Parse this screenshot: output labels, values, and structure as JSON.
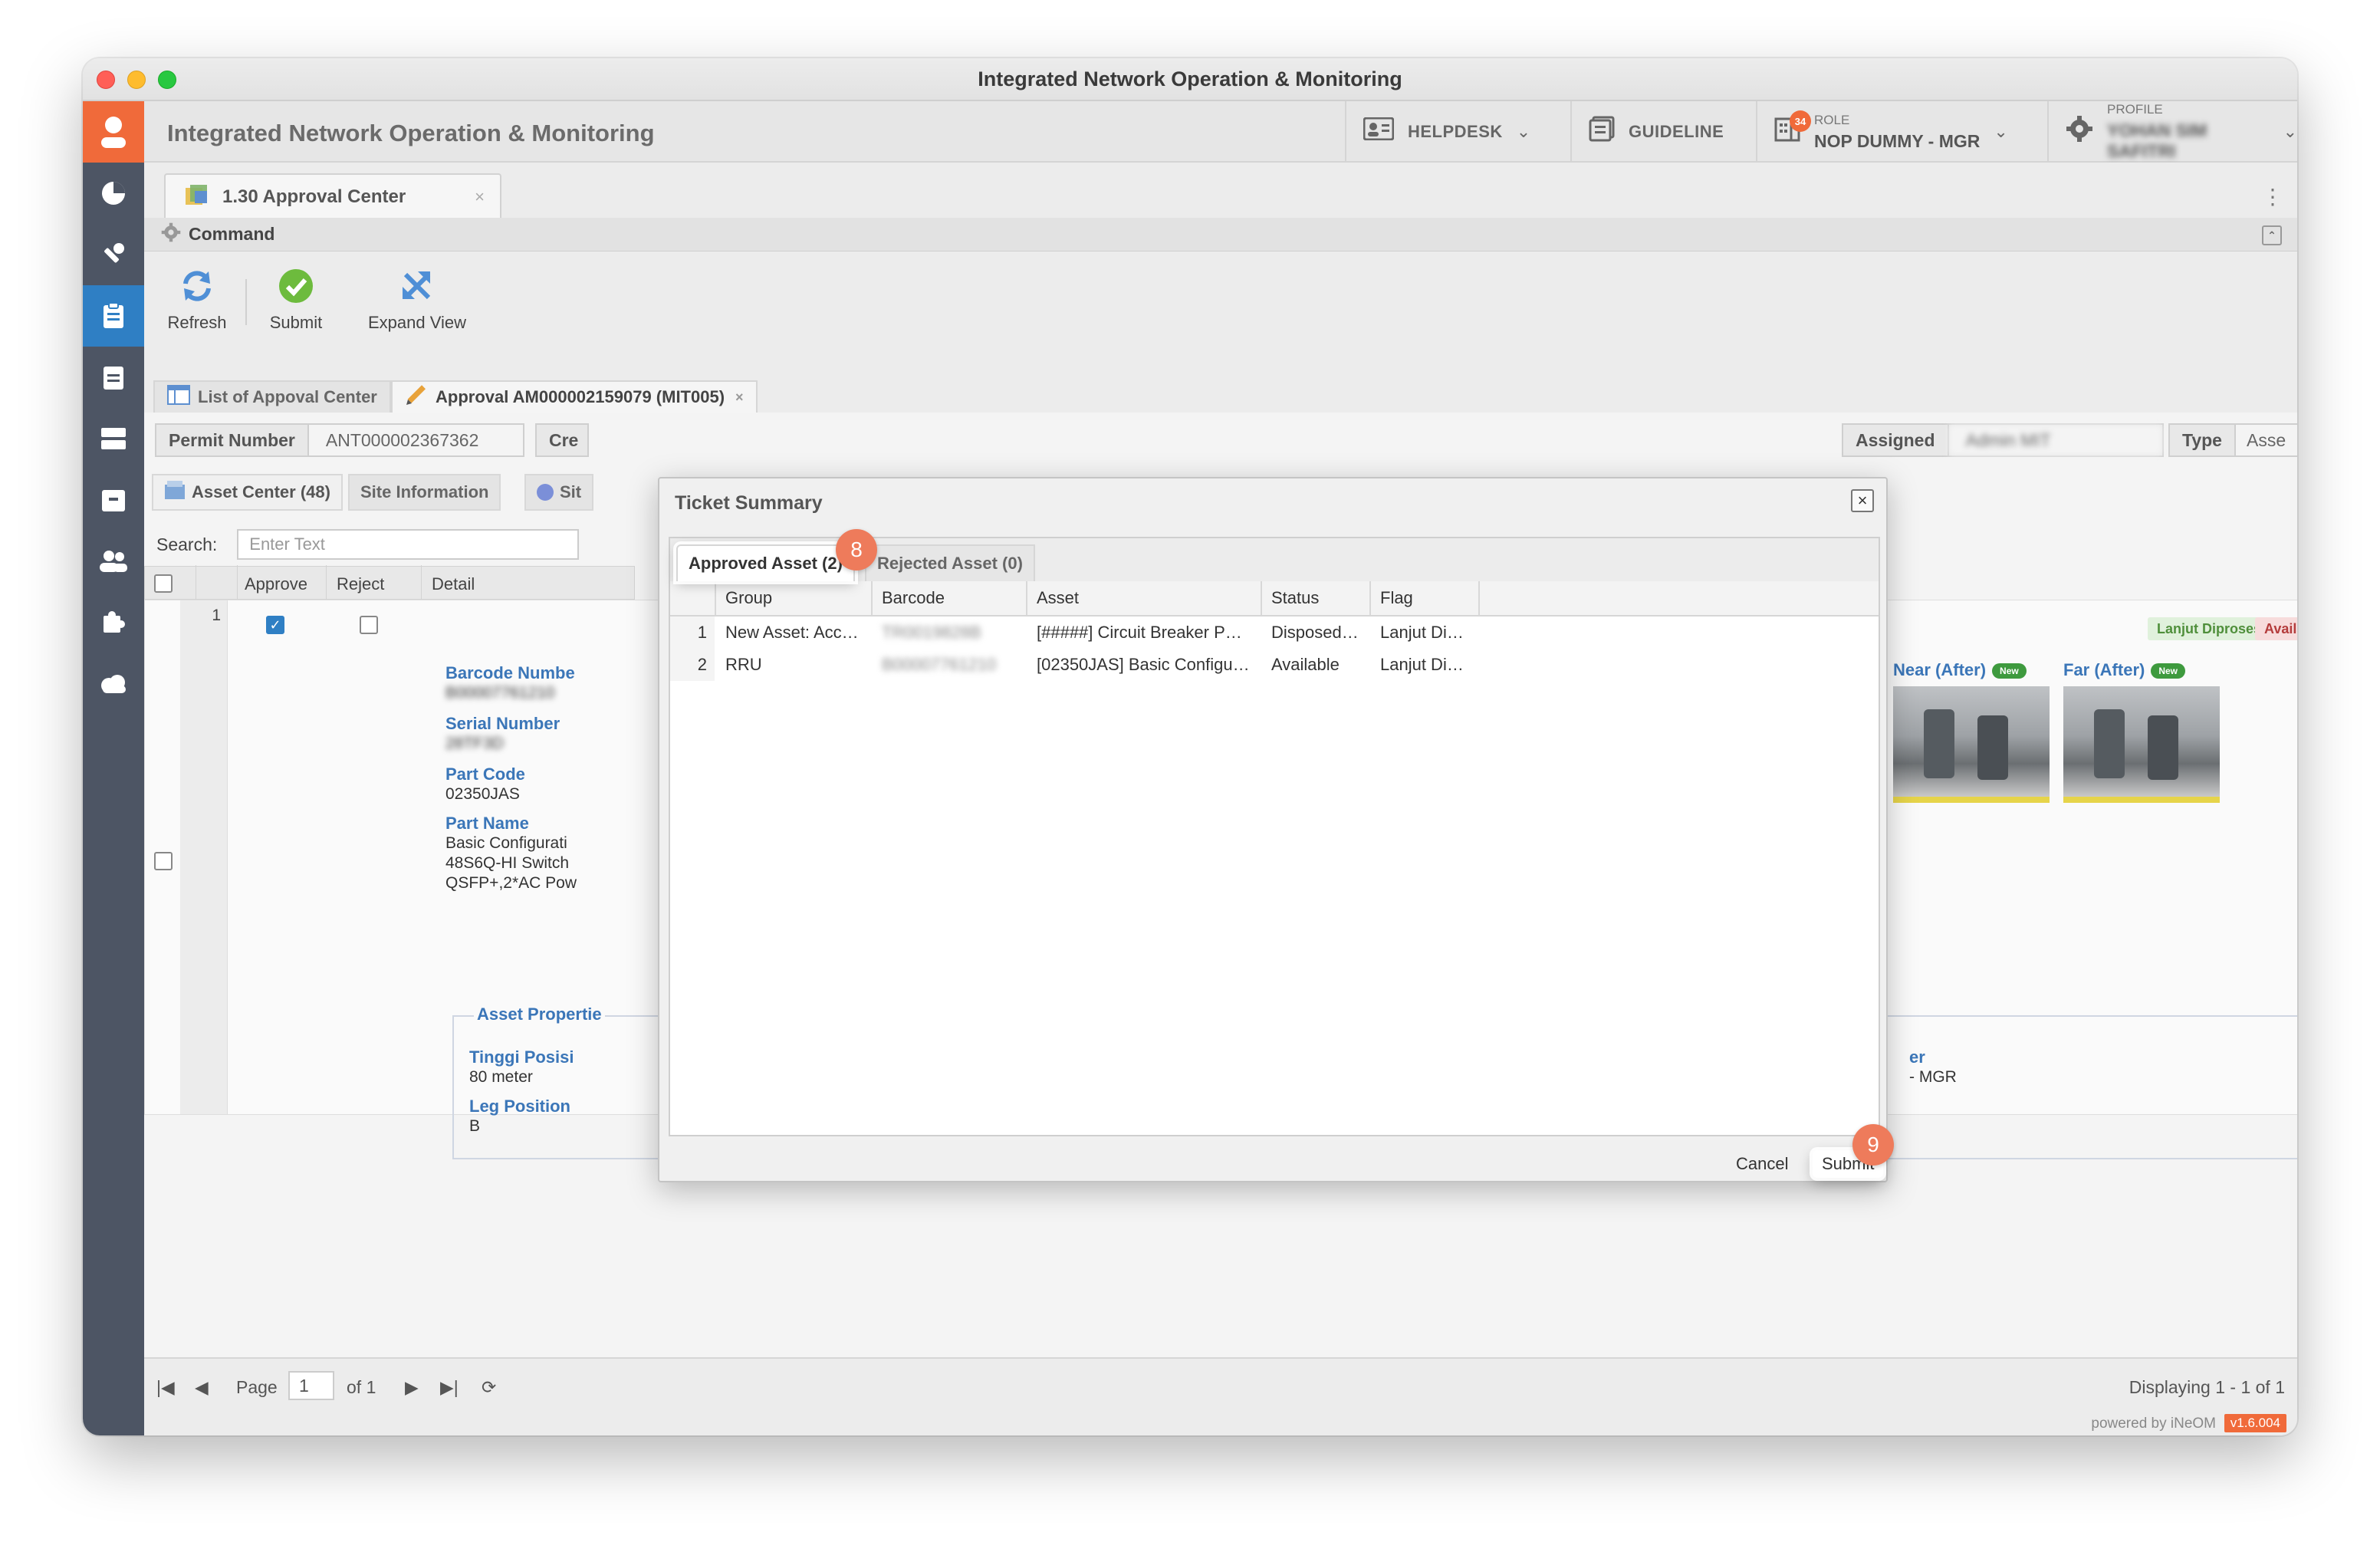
{
  "window": {
    "title": "Integrated Network Operation & Monitoring"
  },
  "header": {
    "app_title": "Integrated Network Operation & Monitoring",
    "helpdesk": "HELPDESK",
    "guideline": "GUIDELINE",
    "role_label": "ROLE",
    "role_value": "NOP DUMMY - MGR",
    "notif_count": "34",
    "profile_label": "PROFILE",
    "profile_value": "YOHAN SIM SAFITRI"
  },
  "main_tab": {
    "label": "1.30 Approval Center",
    "close": "×"
  },
  "command": {
    "title": "Command"
  },
  "toolbar": {
    "refresh": "Refresh",
    "submit": "Submit",
    "expand": "Expand View"
  },
  "subtabs": {
    "list": "List of Appoval Center",
    "approval": "Approval AM000002159079 (MIT005)"
  },
  "fields": {
    "permit_label": "Permit Number",
    "permit_value": "ANT000002367362",
    "created_label": "Cre",
    "assigned_label": "Assigned",
    "assigned_value": "Admin MIT",
    "type_label": "Type",
    "type_value": "Asse"
  },
  "inner_tabs": {
    "asset_center": "Asset Center (48)",
    "site_info": "Site Information",
    "site_other": "Sit"
  },
  "search": {
    "label": "Search:",
    "placeholder": "Enter Text"
  },
  "grid": {
    "headers": {
      "approve": "Approve",
      "reject": "Reject",
      "detail": "Detail"
    },
    "row_num": "1"
  },
  "detail": {
    "barcode_label": "Barcode Numbe",
    "barcode_value": "B00007761210",
    "serial_label": "Serial Number",
    "serial_value": "28TF3D",
    "partcode_label": "Part Code",
    "partcode_value": "02350JAS",
    "partname_label": "Part Name",
    "partname_lines": [
      "Basic Configurati",
      "48S6Q-HI Switch",
      "QSFP+,2*AC Pow"
    ],
    "props_title": "Asset Propertie",
    "tinggi_label": "Tinggi Posisi",
    "tinggi_value": "80 meter",
    "leg_label": "Leg Position",
    "leg_value": "B",
    "right_label": "er",
    "right_value": "- MGR"
  },
  "tags": {
    "lanjut": "Lanjut Diproses",
    "available": "Available"
  },
  "photos": {
    "near": "Near (After)",
    "far": "Far (After)",
    "new_pill": "New"
  },
  "pager": {
    "page_label": "Page",
    "page_value": "1",
    "of": "of 1",
    "displaying": "Displaying 1 - 1 of 1"
  },
  "footer": {
    "powered": "powered by iNeOM",
    "version": "v1.6.004"
  },
  "modal": {
    "title": "Ticket Summary",
    "close": "×",
    "tabs": {
      "approved": "Approved Asset (2)",
      "rejected": "Rejected Asset (0)"
    },
    "columns": {
      "group": "Group",
      "barcode": "Barcode",
      "asset": "Asset",
      "status": "Status",
      "flag": "Flag"
    },
    "rows": [
      {
        "num": "1",
        "group": "New Asset: Acc…",
        "barcode": "TR0019828B",
        "asset": "[#####] Circuit Breaker P…",
        "status": "Disposed…",
        "flag": "Lanjut Di…"
      },
      {
        "num": "2",
        "group": "RRU",
        "barcode": "B00007761210",
        "asset": "[02350JAS] Basic Configu…",
        "status": "Available",
        "flag": "Lanjut Di…"
      }
    ],
    "cancel": "Cancel",
    "submit": "Submit",
    "step_tab": "8",
    "step_submit": "9"
  },
  "colors": {
    "accent": "#f06a3a",
    "sidebar": "#4d5564",
    "active": "#2f7fc4",
    "label_blue": "#3b76b8"
  }
}
